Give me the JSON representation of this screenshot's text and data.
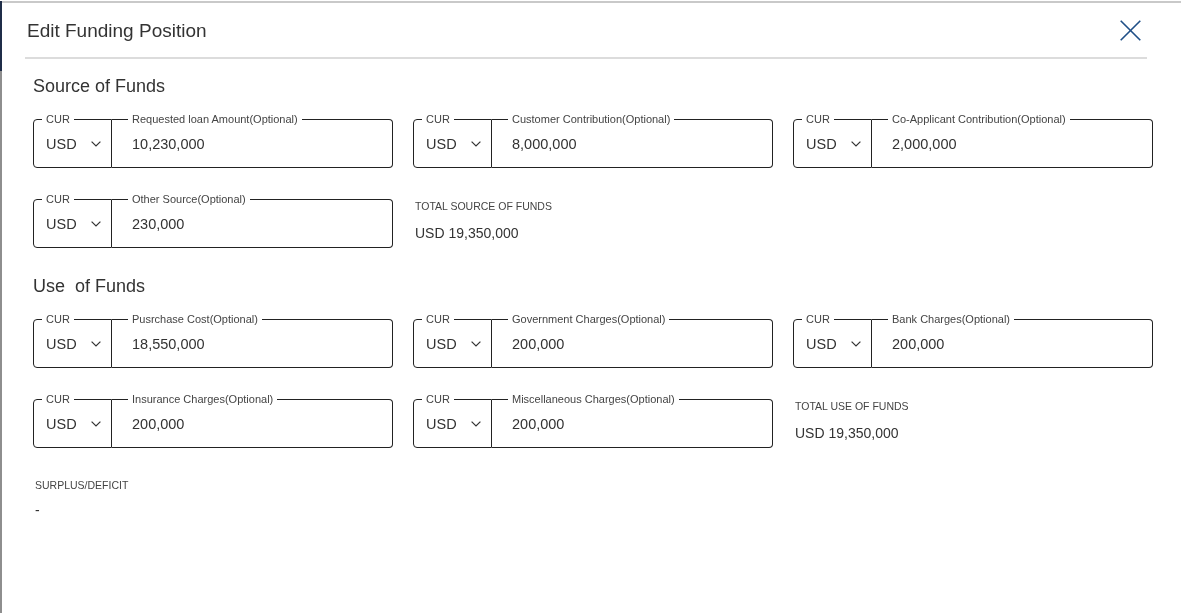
{
  "dialog": {
    "title": "Edit Funding Position"
  },
  "sections": [
    {
      "heading": "Source of Funds",
      "fields": [
        {
          "currency_label": "CUR",
          "currency": "USD",
          "label": "Requested loan Amount(Optional)",
          "value": "10,230,000"
        },
        {
          "currency_label": "CUR",
          "currency": "USD",
          "label": "Customer Contribution(Optional)",
          "value": "8,000,000"
        },
        {
          "currency_label": "CUR",
          "currency": "USD",
          "label": "Co-Applicant Contribution(Optional)",
          "value": "2,000,000"
        },
        {
          "currency_label": "CUR",
          "currency": "USD",
          "label": "Other Source(Optional)",
          "value": "230,000"
        }
      ],
      "total": {
        "label": "TOTAL SOURCE OF FUNDS",
        "value": "USD 19,350,000"
      }
    },
    {
      "heading": "Use  of Funds",
      "fields": [
        {
          "currency_label": "CUR",
          "currency": "USD",
          "label": "Pusrchase Cost(Optional)",
          "value": "18,550,000"
        },
        {
          "currency_label": "CUR",
          "currency": "USD",
          "label": "Government Charges(Optional)",
          "value": "200,000"
        },
        {
          "currency_label": "CUR",
          "currency": "USD",
          "label": "Bank Charges(Optional)",
          "value": "200,000"
        },
        {
          "currency_label": "CUR",
          "currency": "USD",
          "label": "Insurance Charges(Optional)",
          "value": "200,000"
        },
        {
          "currency_label": "CUR",
          "currency": "USD",
          "label": "Miscellaneous Charges(Optional)",
          "value": "200,000"
        }
      ],
      "total": {
        "label": "TOTAL USE OF FUNDS",
        "value": "USD 19,350,000"
      }
    }
  ],
  "surplus_deficit": {
    "label": "SURPLUS/DEFICIT",
    "value": "-"
  }
}
